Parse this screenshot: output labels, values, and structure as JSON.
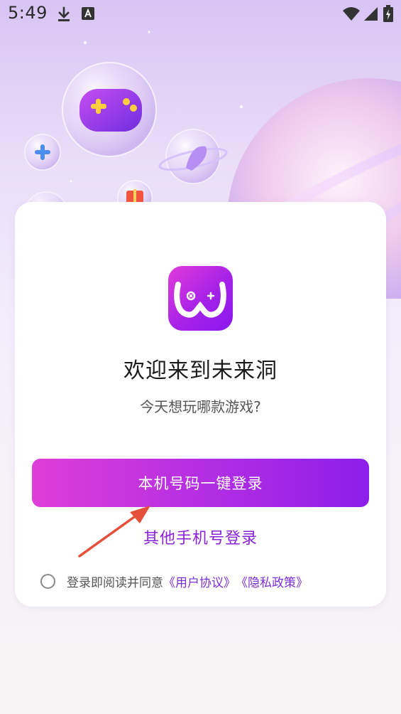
{
  "status_bar": {
    "time": "5:49",
    "icons": [
      "download-icon",
      "keyboard-a-icon",
      "wifi-icon",
      "signal-icon",
      "battery-charging-icon"
    ]
  },
  "card": {
    "logo_icon": "app-logo-gamepad",
    "title": "欢迎来到未来洞",
    "subtitle": "今天想玩哪款游戏?",
    "primary_button": "本机号码一键登录",
    "secondary_link": "其他手机号登录",
    "agreement": {
      "prefix": "登录即阅读并同意",
      "user_agreement": "《用户协议》",
      "privacy_policy": "《隐私政策》",
      "checked": false
    }
  },
  "colors": {
    "accent_start": "#df3ed8",
    "accent_end": "#8d1ee9",
    "link": "#8a23d8",
    "annotation_arrow": "#e5503b"
  }
}
